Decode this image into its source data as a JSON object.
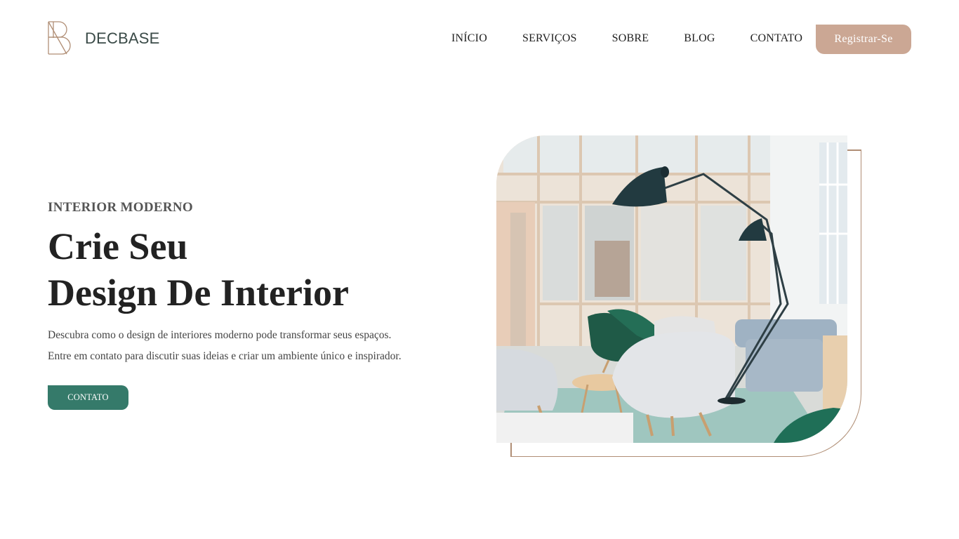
{
  "brand": {
    "name": "DECBASE",
    "accent_color": "#cba794",
    "primary_color": "#357a6a",
    "frame_color": "#b08e75"
  },
  "nav": {
    "items": [
      "INÍCIO",
      "SERVIÇOS",
      "SOBRE",
      "BLOG",
      "CONTATO"
    ],
    "register_label": "Registrar-Se"
  },
  "hero": {
    "eyebrow": "INTERIOR MODERNO",
    "headline_line1": "Crie Seu",
    "headline_line2": "Design De Interior",
    "description_line1": "Descubra como o design de interiores moderno pode transformar seus espaços.",
    "description_line2": "Entre em contato para discutir suas ideias e criar um ambiente único e inspirador.",
    "cta_label": "CONTATO"
  }
}
